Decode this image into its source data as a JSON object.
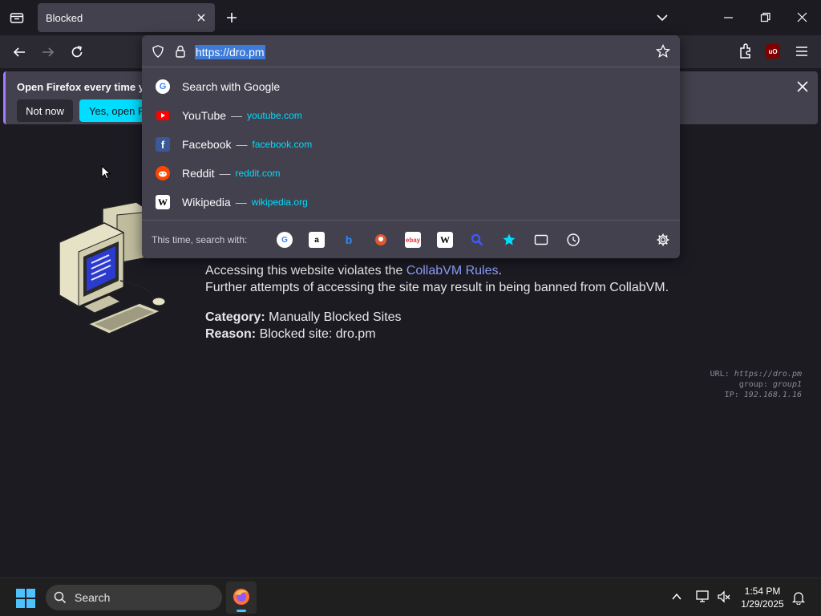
{
  "browser": {
    "tab": {
      "title": "Blocked"
    },
    "url": "https://dro.pm"
  },
  "notification": {
    "message": "Open Firefox every time you",
    "not_now": "Not now",
    "accept": "Yes, open Firef"
  },
  "dropdown": {
    "suggestions": [
      {
        "icon": "google-icon",
        "title": "Search with Google",
        "url": ""
      },
      {
        "icon": "youtube-icon",
        "title": "YouTube",
        "url": "youtube.com"
      },
      {
        "icon": "facebook-icon",
        "title": "Facebook",
        "url": "facebook.com"
      },
      {
        "icon": "reddit-icon",
        "title": "Reddit",
        "url": "reddit.com"
      },
      {
        "icon": "wikipedia-icon",
        "title": "Wikipedia",
        "url": "wikipedia.org"
      }
    ],
    "dash": "—",
    "oneoff_label": "This time, search with:",
    "engines": [
      "google-icon",
      "amazon-icon",
      "bing-icon",
      "duckduckgo-icon",
      "ebay-icon",
      "wikipedia-icon",
      "search-engine-icon",
      "bookmarks-star-icon",
      "tabs-icon",
      "history-icon"
    ]
  },
  "page": {
    "line1": "Accessing this website violates the ",
    "rules_link": "CollabVM Rules",
    "line1_end": ".",
    "line2": "Further attempts of accessing the site may result in being banned from CollabVM.",
    "category_label": "Category:",
    "category_value": " Manually Blocked Sites",
    "reason_label": "Reason:",
    "reason_value": " Blocked site: dro.pm",
    "meta": {
      "url_label": "URL: ",
      "url_value": "https://dro.pm",
      "group_label": "group: ",
      "group_value": "group1",
      "ip_label": "IP: ",
      "ip_value": "192.168.1.16"
    }
  },
  "taskbar": {
    "search": "Search",
    "time": "1:54 PM",
    "date": "1/29/2025"
  },
  "colors": {
    "accent": "#00ddff",
    "panel": "#42414d",
    "link": "#8fa2ff"
  }
}
